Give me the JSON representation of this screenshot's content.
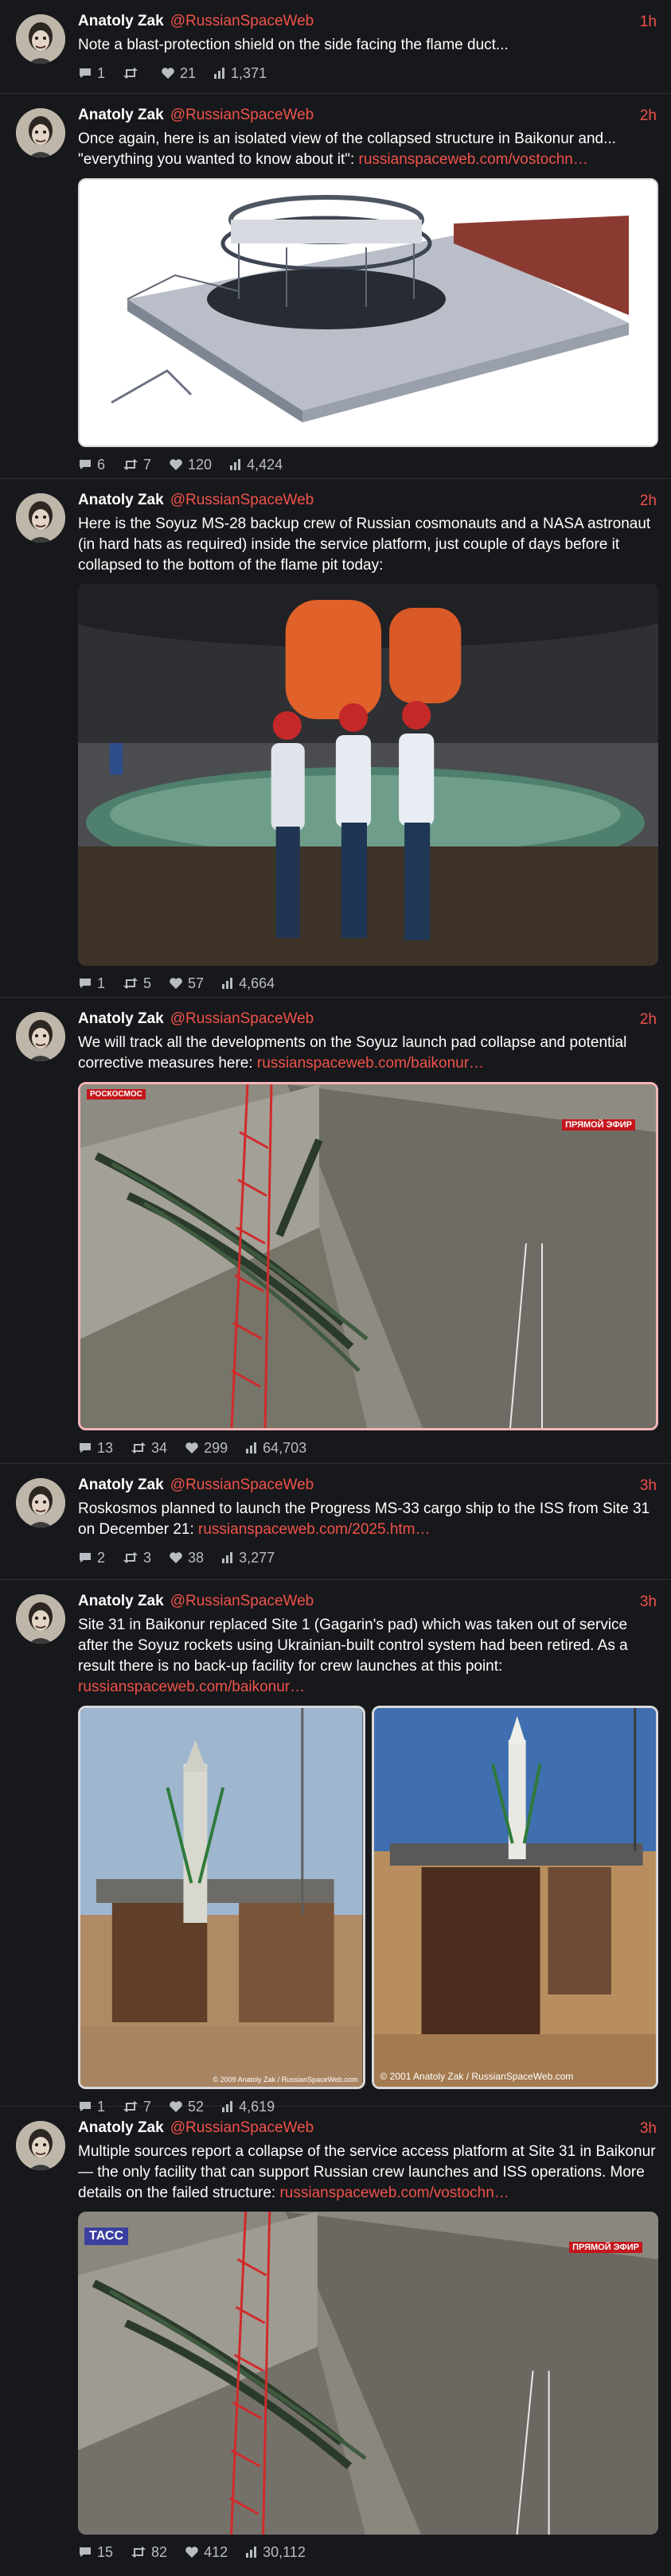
{
  "account": {
    "name": "Anatoly Zak",
    "handle": "@RussianSpaceWeb"
  },
  "tweets": [
    {
      "time": "1h",
      "text": "Note a blast-protection shield on the side facing the flame duct...",
      "link": "",
      "stats": {
        "replies": "1",
        "retweets": "",
        "likes": "21",
        "views": "1,371"
      }
    },
    {
      "time": "2h",
      "text": "Once again, here is an isolated view of the collapsed structure in Baikonur and... \"everything you wanted to know about it\": ",
      "link": "russianspaceweb.com/vostochn…",
      "stats": {
        "replies": "6",
        "retweets": "7",
        "likes": "120",
        "views": "4,424"
      }
    },
    {
      "time": "2h",
      "text": "Here is the Soyuz MS-28 backup crew of Russian cosmonauts and a NASA astronaut (in hard hats as required) inside the service platform, just couple of days before it collapsed to the bottom of the flame pit today:",
      "link": "",
      "stats": {
        "replies": "1",
        "retweets": "5",
        "likes": "57",
        "views": "4,664"
      }
    },
    {
      "time": "2h",
      "text": "We will track all the developments on the Soyuz launch pad collapse and potential corrective measures here: ",
      "link": "russianspaceweb.com/baikonur…",
      "overlay_left": "РОСКОСМОС",
      "overlay_right": "ПРЯМОЙ ЭФИР",
      "stats": {
        "replies": "13",
        "retweets": "34",
        "likes": "299",
        "views": "64,703"
      }
    },
    {
      "time": "3h",
      "text": "Roskosmos planned to launch the Progress MS-33 cargo ship to the ISS from Site 31 on December 21: ",
      "link": "russianspaceweb.com/2025.htm…",
      "stats": {
        "replies": "2",
        "retweets": "3",
        "likes": "38",
        "views": "3,277"
      }
    },
    {
      "time": "3h",
      "text": "Site 31 in Baikonur replaced Site 1 (Gagarin's pad) which was taken out of service after the Soyuz rockets using Ukrainian-built control system had been retired. As a result there is no back-up facility for crew launches at this point: ",
      "link": "russianspaceweb.com/baikonur…",
      "caption_left": "© 2009 Anatoly Zak / RussianSpaceWeb.com",
      "caption_right": "© 2001 Anatoly Zak / RussianSpaceWeb.com",
      "stats": {
        "replies": "1",
        "retweets": "7",
        "likes": "52",
        "views": "4,619"
      }
    },
    {
      "time": "3h",
      "text": "Multiple sources report a collapse of the service access platform at Site 31 in Baikonur — the only facility that can support Russian crew launches and ISS operations. More details on the failed structure: ",
      "link": "russianspaceweb.com/vostochn…",
      "overlay_left": "ТАСС",
      "overlay_right": "ПРЯМОЙ ЭФИР",
      "stats": {
        "replies": "15",
        "retweets": "82",
        "likes": "412",
        "views": "30,112"
      }
    }
  ],
  "icons": [
    "reply-icon",
    "retweet-icon",
    "like-icon",
    "views-icon"
  ],
  "colors": {
    "background": "#17181b",
    "accent": "#f0524a",
    "muted": "#b9bcc2",
    "divider": "#2d2f33"
  }
}
